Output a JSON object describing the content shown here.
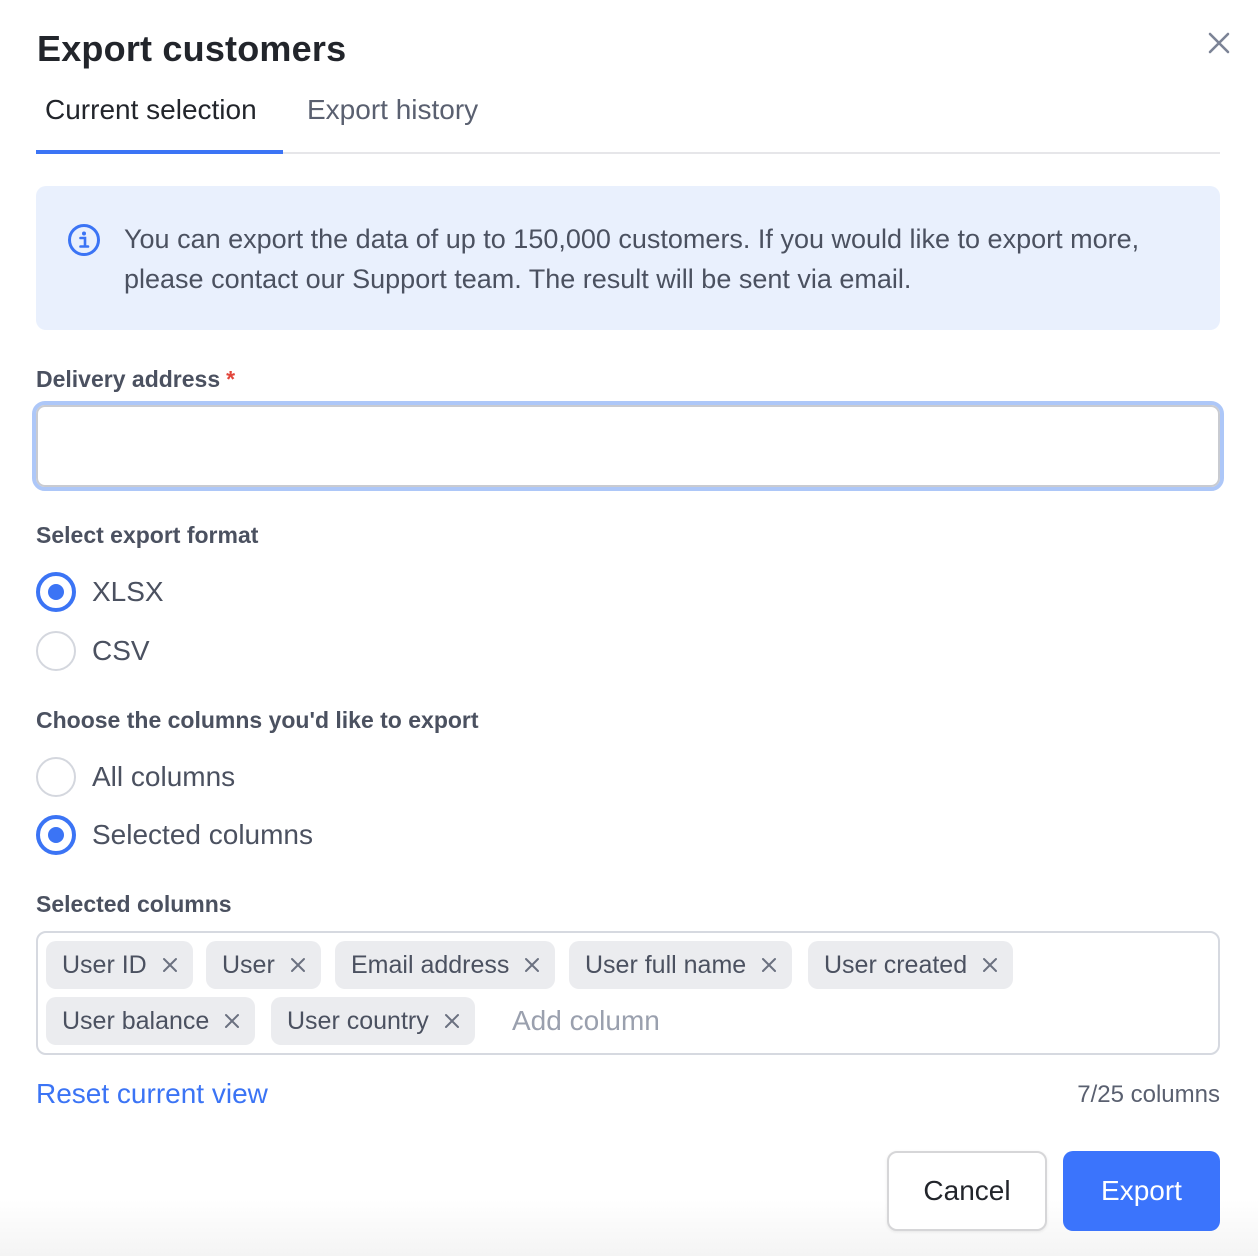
{
  "dialog": {
    "title": "Export customers",
    "close_icon": "close-icon"
  },
  "tabs": [
    {
      "label": "Current selection",
      "active": true
    },
    {
      "label": "Export history",
      "active": false
    }
  ],
  "info": {
    "icon": "info-icon",
    "text": "You can export the data of up to 150,000 customers. If you would like to export more, please contact our Support team. The result will be sent via email."
  },
  "delivery": {
    "label": "Delivery address",
    "required_marker": "*",
    "value": "",
    "placeholder": ""
  },
  "format": {
    "label": "Select export format",
    "options": [
      {
        "label": "XLSX",
        "checked": true
      },
      {
        "label": "CSV",
        "checked": false
      }
    ]
  },
  "columns_choice": {
    "label": "Choose the columns you'd like to export",
    "options": [
      {
        "label": "All columns",
        "checked": false
      },
      {
        "label": "Selected columns",
        "checked": true
      }
    ]
  },
  "selected_columns": {
    "label": "Selected columns",
    "chips": [
      "User ID",
      "User",
      "Email address",
      "User full name",
      "User created",
      "User balance",
      "User country"
    ],
    "add_placeholder": "Add column"
  },
  "footer": {
    "reset_label": "Reset current view",
    "count_text": "7/25 columns",
    "cancel_label": "Cancel",
    "export_label": "Export"
  },
  "colors": {
    "accent": "#3b74f5",
    "info_bg": "#e9f0fd",
    "required": "#e2463c"
  }
}
